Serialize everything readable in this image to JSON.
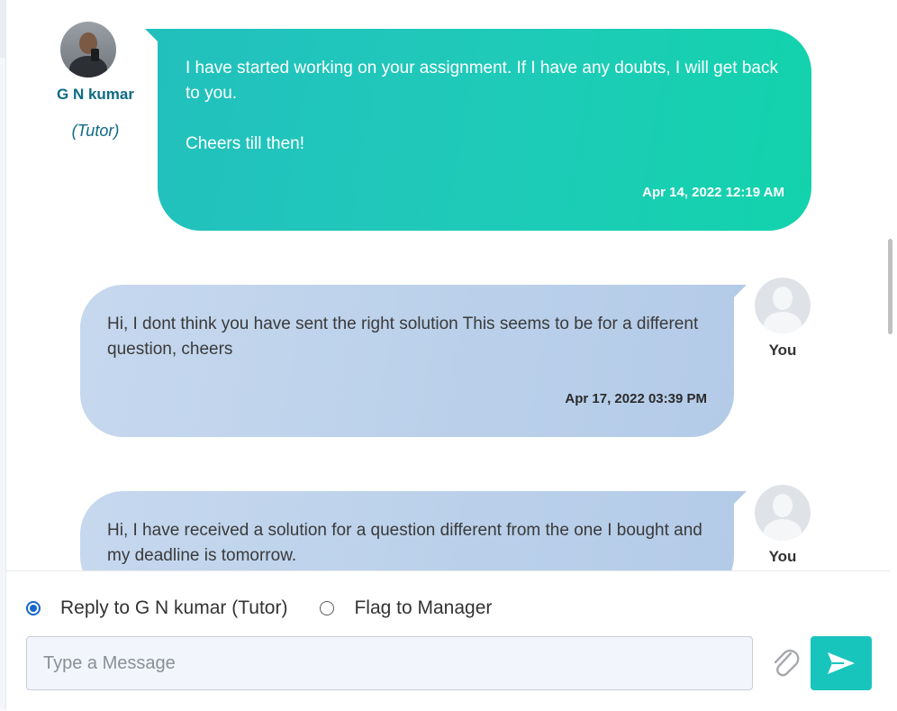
{
  "messages": [
    {
      "sender": "tutor",
      "name": "G N kumar",
      "role": "(Tutor)",
      "text": "I have started working on your assignment. If I have any doubts, I will get back to you.\n\nCheers till then!",
      "timestamp": "Apr 14, 2022 12:19 AM",
      "avatar_icon": "tutor-photo-avatar"
    },
    {
      "sender": "user",
      "name": "You",
      "text": "Hi, I dont think you have sent the right solution This seems to be for a different question, cheers",
      "timestamp": "Apr 17, 2022 03:39 PM",
      "avatar_icon": "default-user-avatar"
    },
    {
      "sender": "user",
      "name": "You",
      "text": "Hi, I have received a solution for a question different from the one I bought and my deadline is tomorrow.",
      "timestamp": "",
      "avatar_icon": "default-user-avatar"
    }
  ],
  "reply_options": {
    "reply_label": "Reply to G N kumar (Tutor)",
    "flag_label": "Flag to Manager",
    "selected": "reply"
  },
  "composer": {
    "placeholder": "Type a Message",
    "value": "",
    "attach_icon": "paperclip-icon",
    "send_icon": "paper-plane-icon"
  },
  "colors": {
    "tutor_bubble": "#1fcab9",
    "user_bubble": "#bad0ea",
    "accent": "#18c5bd",
    "name_color": "#0e6a86"
  }
}
